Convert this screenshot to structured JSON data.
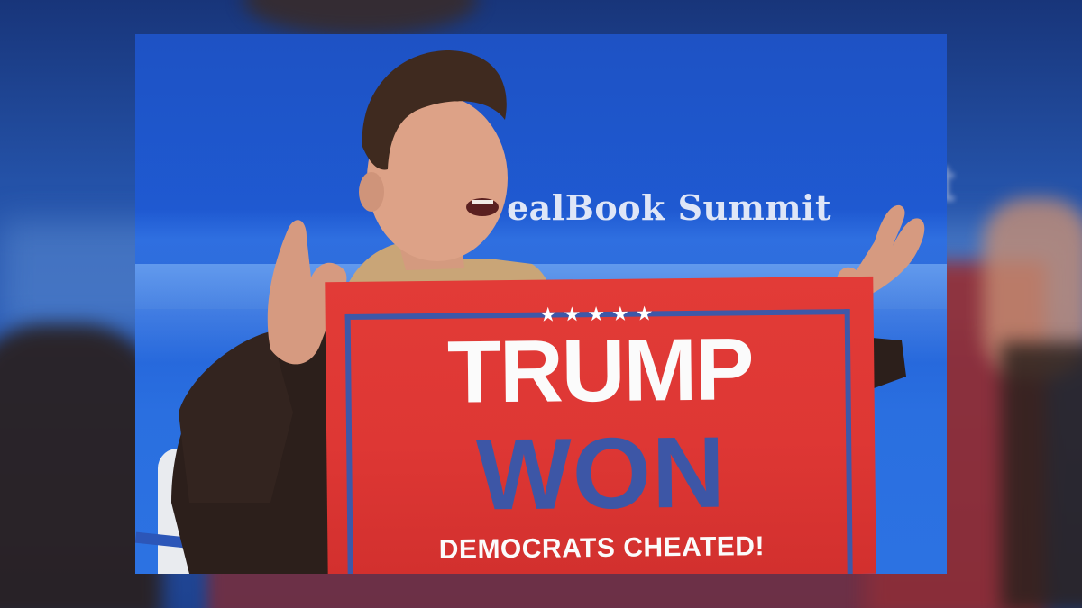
{
  "image": {
    "description_free": true,
    "event_banner": {
      "text": "ealBook Summit"
    },
    "flag": {
      "stars": "★★★★★",
      "line1": "TRUMP",
      "line2": "WON",
      "line3": "DEMOCRATS CHEATED!"
    },
    "backdrop_text": "t"
  },
  "colors": {
    "stage_blue": "#1f5bd4",
    "flag_red": "#e23b37",
    "flag_blue": "#3d56a6",
    "flag_white": "#fbfbfb"
  }
}
